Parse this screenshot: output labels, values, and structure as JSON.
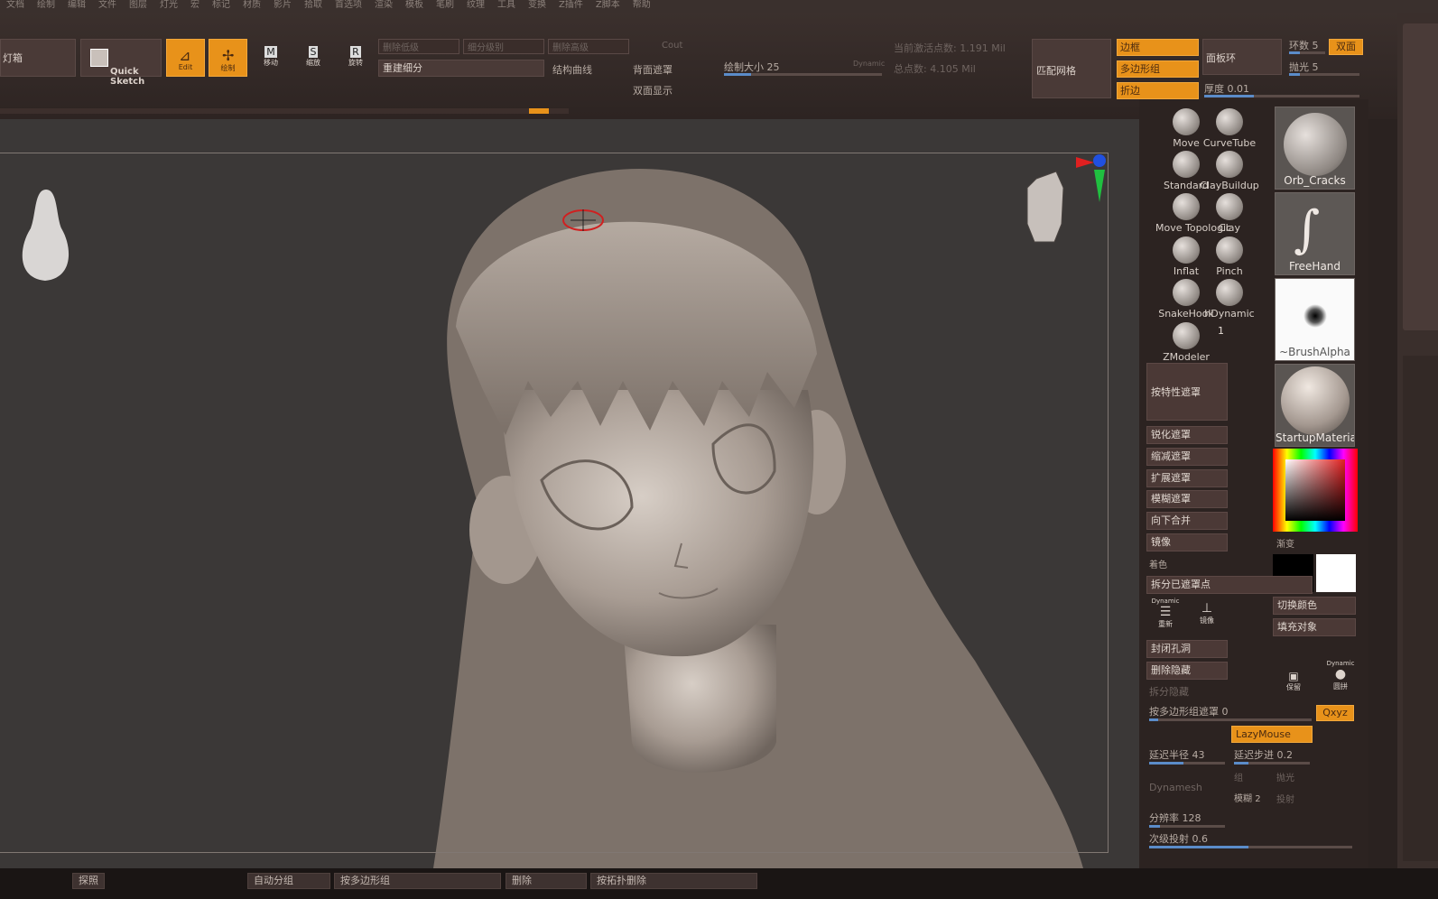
{
  "menu": [
    "文档",
    "绘制",
    "编辑",
    "文件",
    "图层",
    "灯光",
    "宏",
    "标记",
    "材质",
    "影片",
    "拾取",
    "首选项",
    "渲染",
    "模板",
    "笔刷",
    "纹理",
    "工具",
    "变换",
    "Z插件",
    "Z脚本",
    "帮助"
  ],
  "toolbar": {
    "left_label": "灯箱",
    "quick_sketch": "Quick\nSketch",
    "edit_label": "Edit",
    "draw_label": "绘制",
    "move_label": "移动",
    "scale_label": "缩放",
    "rotate_label": "旋转",
    "move_key": "M",
    "scale_key": "S",
    "rotate_key": "R",
    "del_lower": "删除低级",
    "subdiv": "细分级别",
    "del_higher": "删除高级",
    "cout": "Cout",
    "rebuild": "重建细分",
    "smooth_curve": "结构曲线",
    "backface_mask": "背面遮罩",
    "double_display": "双面显示",
    "draw_size_label": "绘制大小",
    "draw_size": "25",
    "dynamic": "Dynamic",
    "active_points_label": "当前激活点数:",
    "active_points": "1.191 Mil",
    "total_points_label": "总点数:",
    "total_points": "4.105 Mil",
    "match_mesh": "匹配网格",
    "border": "边框",
    "polygroup": "多边形组",
    "crease": "折边",
    "panel_loop": "面板环",
    "thickness_label": "厚度",
    "thickness": "0.01",
    "loop_label": "环数",
    "loop": "5",
    "double_side": "双面",
    "polish_label": "抛光",
    "polish": "5"
  },
  "brushes": [
    {
      "name": "Move"
    },
    {
      "name": "CurveTube"
    },
    {
      "name": "Standard"
    },
    {
      "name": "ClayBuildup"
    },
    {
      "name": "Move Topologic"
    },
    {
      "name": "Clay"
    },
    {
      "name": "Inflat"
    },
    {
      "name": "Pinch"
    },
    {
      "name": "SnakeHook"
    },
    {
      "name": "hDynamic"
    },
    {
      "name": "ZModeler"
    }
  ],
  "zmodeler_count": "1",
  "thumbs": {
    "orb": "Orb_Cracks",
    "freehand": "FreeHand",
    "alpha": "~BrushAlpha",
    "material": "StartupMaterial",
    "gradient": "渐变",
    "switch_color": "切换颜色",
    "fill_object": "填充对象",
    "color_label": "着色"
  },
  "mask_buttons": {
    "mask_by_feature": "按特性遮罩",
    "sharpen": "锐化遮罩",
    "shrink": "缩减遮罩",
    "grow": "扩展遮罩",
    "blur": "模糊遮罩",
    "merge_down": "向下合并",
    "mirror": "镜像",
    "split_masked": "拆分已遮罩点",
    "close_holes": "封闭孔洞",
    "del_hidden": "删除隐藏",
    "split_hidden": "拆分隐藏",
    "mask_by_polygroup_label": "按多边形组遮罩",
    "mask_by_polygroup": "0",
    "qxyz": "Qxyz",
    "lazymouse": "LazyMouse",
    "lazy_radius_label": "延迟半径",
    "lazy_radius": "43",
    "lazy_step_label": "延迟步进",
    "lazy_step": "0.2",
    "dynamesh": "Dynamesh",
    "group": "组",
    "polish": "抛光",
    "blur2": "模糊",
    "blur2_val": "2",
    "project": "投射",
    "resolution_label": "分辨率",
    "resolution": "128",
    "subproject_label": "次级投射",
    "subproject": "0.6",
    "dyn_small": "Dynamic",
    "rebuild_small": "重新",
    "mirror_small": "镜像",
    "dyn2": "Dynamic",
    "dyn2_sub": "圆拼",
    "hold": "保留"
  },
  "status": {
    "a": "探照",
    "b": "自动分组",
    "c": "按多边形组",
    "d": "删除",
    "e": "按拓扑删除"
  },
  "colors": {
    "orange": "#e8921a",
    "panel": "#2c2321",
    "viewport": "#3b3837"
  }
}
